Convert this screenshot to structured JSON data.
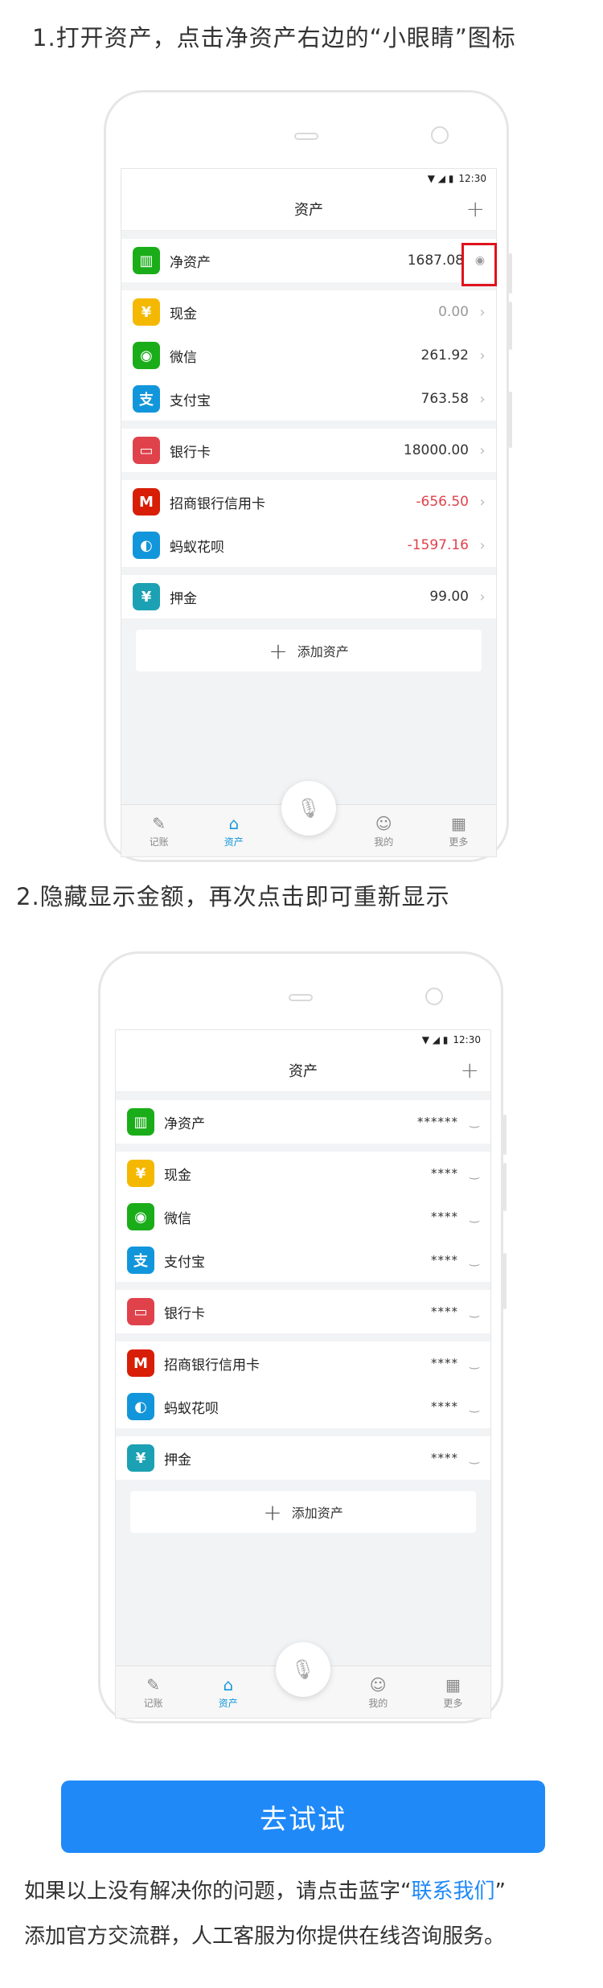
{
  "step1": {
    "title": "1.打开资产，点击净资产右边的“小眼睛”图标"
  },
  "step2": {
    "title": "2.隐藏显示金额，再次点击即可重新显示"
  },
  "status": {
    "time": "12:30",
    "icons": "▼ ◢ ▮"
  },
  "nav": {
    "title": "资产",
    "plus": "+"
  },
  "rows": [
    {
      "name": "净资产",
      "value": "1687.08",
      "icon_text": "▥",
      "color": "#1aad19",
      "value_style": "normal"
    },
    {
      "name": "现金",
      "value": "0.00",
      "icon_text": "¥",
      "color": "#f5b800",
      "value_style": "grey"
    },
    {
      "name": "微信",
      "value": "261.92",
      "icon_text": "◉",
      "color": "#1aad19",
      "value_style": "normal"
    },
    {
      "name": "支付宝",
      "value": "763.58",
      "icon_text": "支",
      "color": "#1296db",
      "value_style": "normal"
    },
    {
      "name": "银行卡",
      "value": "18000.00",
      "icon_text": "▭",
      "color": "#e0424b",
      "value_style": "normal"
    },
    {
      "name": "招商银行信用卡",
      "value": "-656.50",
      "icon_text": "M",
      "color": "#d81e06",
      "value_style": "red"
    },
    {
      "name": "蚂蚁花呗",
      "value": "-1597.16",
      "icon_text": "◐",
      "color": "#1296db",
      "value_style": "red"
    },
    {
      "name": "押金",
      "value": "99.00",
      "icon_text": "¥",
      "color": "#1ba1b3",
      "value_style": "normal"
    }
  ],
  "hidden": {
    "net_value": "******",
    "value": "****"
  },
  "add_label": "添加资产",
  "tabs": [
    {
      "label": "记账",
      "icon": "✎"
    },
    {
      "label": "资产",
      "icon": "⌂"
    },
    {
      "label": "我的",
      "icon": "☺"
    },
    {
      "label": "更多",
      "icon": "▦"
    }
  ],
  "mic_icon": "🎙",
  "eye_open": "◉",
  "eye_closed": "‿",
  "chevron": "›",
  "try_button": "去试试",
  "footer": {
    "line1_a": "如果以上没有解决你的问题，请点击蓝字“",
    "link": "联系我们",
    "line1_b": "”",
    "line2": "添加官方交流群，人工客服为你提供在线咨询服务。"
  }
}
